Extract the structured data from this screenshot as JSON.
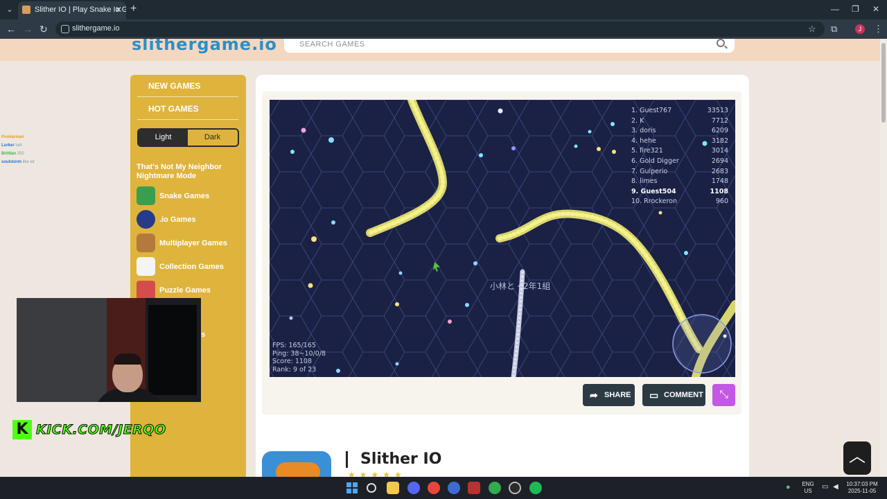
{
  "browser": {
    "tab_title": "Slither IO | Play Snake Io Game",
    "url": "slithergame.io",
    "profile_initial": "J",
    "icons": [
      "tab-menu-icon",
      "close-icon",
      "new-tab-icon",
      "back-icon",
      "forward-icon",
      "reload-icon",
      "site-info-icon",
      "bookmark-star-icon",
      "extensions-icon",
      "menu-icon",
      "minimize-icon",
      "maximize-icon",
      "window-close-icon"
    ]
  },
  "site": {
    "logo_text": "slithergame.io",
    "search_placeholder": "SEARCH GAMES",
    "nav": {
      "new_games": "NEW GAMES",
      "hot_games": "HOT GAMES"
    },
    "theme": {
      "light": "Light",
      "dark": "Dark",
      "selected": "Light"
    },
    "promo": "That's Not My Neighbor Nightmare Mode",
    "categories": [
      {
        "label": "Snake Games",
        "icon": "snake-icon"
      },
      {
        "label": ".io Games",
        "icon": "io-icon"
      },
      {
        "label": "Multiplayer Games",
        "icon": "people-icon"
      },
      {
        "label": "Collection Games",
        "icon": "collection-icon"
      },
      {
        "label": "Puzzle Games",
        "icon": "puzzle-icon"
      }
    ],
    "partial_category_tail": "es",
    "actions": {
      "share": "SHARE",
      "comment": "COMMENT"
    },
    "game_title": "Slither IO",
    "rating_stars": "★★★★★"
  },
  "game": {
    "leaderboard": [
      {
        "rank": "1.",
        "name": "Guest767",
        "score": "33513"
      },
      {
        "rank": "2.",
        "name": "K",
        "score": "7712"
      },
      {
        "rank": "3.",
        "name": "doris",
        "score": "6209"
      },
      {
        "rank": "4.",
        "name": "hehe",
        "score": "3182"
      },
      {
        "rank": "5.",
        "name": "fire321",
        "score": "3014"
      },
      {
        "rank": "6.",
        "name": "Gold Digger",
        "score": "2694"
      },
      {
        "rank": "7.",
        "name": "Gulperio",
        "score": "2683"
      },
      {
        "rank": "8.",
        "name": "limes",
        "score": "1748"
      },
      {
        "rank": "9.",
        "name": "Guest504",
        "score": "1108",
        "me": true
      },
      {
        "rank": "10.",
        "name": "Rrockeron",
        "score": "960"
      }
    ],
    "stats": {
      "fps": "FPS: 165/165",
      "ping": "Ping: 38~10/0/8",
      "score": "Score: 1108",
      "rank": "Rank: 9 of 23"
    },
    "nickname": "小林と・2年1組"
  },
  "overlay": {
    "chat": [
      {
        "name": "Pookarman",
        "msg": ""
      },
      {
        "name": "Lurker",
        "msg": "lurk"
      },
      {
        "name": "Brittlan",
        "msg": "250"
      },
      {
        "name": "soulstorm",
        "msg": "like wt"
      }
    ],
    "kick_logo": "K",
    "kick_text": "KICK.COM/JERQO"
  },
  "taskbar": {
    "lang": "ENG",
    "region": "US",
    "time": "10:37:03 PM",
    "date": "2025-11-05",
    "apps": [
      "windows-start-icon",
      "search-icon",
      "file-explorer-icon",
      "discord-icon",
      "chrome-icon",
      "app-icon",
      "voicemeeter-icon",
      "chrome-profile-icon",
      "obs-icon",
      "spotify-icon"
    ]
  },
  "colors": {
    "sidebar": "#dfb43d",
    "game_bg": "#1a2144",
    "snake": "#f3f07a",
    "full_button": "#c258e3",
    "kick_green": "#53fc18"
  }
}
